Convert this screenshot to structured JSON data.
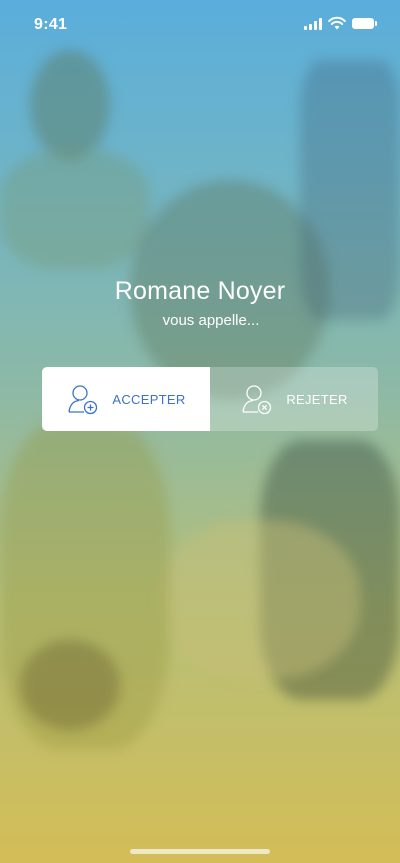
{
  "status_bar": {
    "time": "9:41",
    "icons": [
      "cellular-signal-icon",
      "wifi-icon",
      "battery-icon"
    ]
  },
  "caller": {
    "name": "Romane Noyer",
    "subtitle": "vous appelle..."
  },
  "actions": {
    "accept": {
      "label": "ACCEPTER",
      "icon": "user-add-icon",
      "color": "#3a73c8"
    },
    "reject": {
      "label": "REJETER",
      "icon": "user-remove-icon",
      "color": "#ffffff"
    }
  },
  "colors": {
    "gradient_top": "#5aaedc",
    "gradient_bottom": "#d3bd57",
    "accent": "#3a73c8"
  }
}
